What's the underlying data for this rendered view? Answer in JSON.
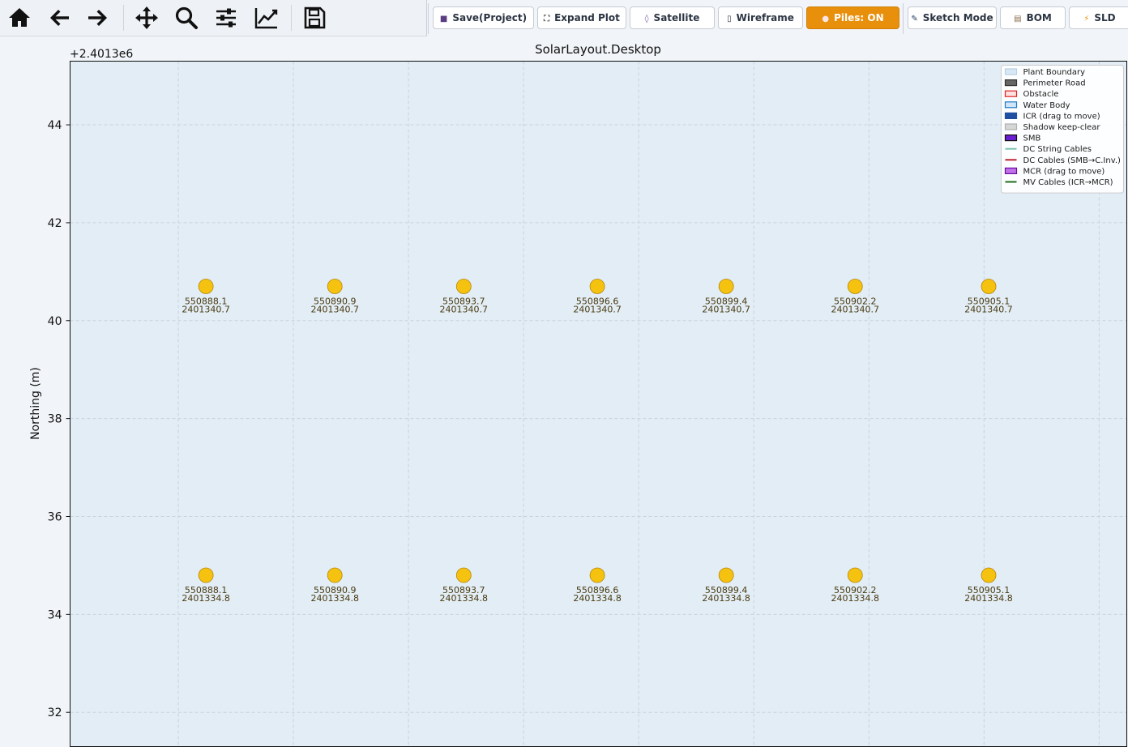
{
  "toolbar": {
    "nav_tools": [
      {
        "name": "home-icon"
      },
      {
        "name": "back-arrow-icon"
      },
      {
        "name": "forward-arrow-icon"
      },
      {
        "name": "pan-icon"
      },
      {
        "name": "zoom-icon"
      },
      {
        "name": "configure-subplots-icon"
      },
      {
        "name": "edit-axis-icon"
      },
      {
        "name": "save-figure-icon"
      }
    ],
    "buttons": [
      {
        "name": "save-project-button",
        "icon": "save-icon",
        "label": "Save(Project)",
        "active": false
      },
      {
        "name": "expand-plot-button",
        "icon": "expand-icon",
        "label": "Expand Plot",
        "active": false
      },
      {
        "name": "satellite-button",
        "icon": "satellite-icon",
        "label": "Satellite",
        "active": false
      },
      {
        "name": "wireframe-button",
        "icon": "wireframe-icon",
        "label": "Wireframe",
        "active": false
      },
      {
        "name": "piles-toggle-button",
        "icon": "pin-icon",
        "label": "Piles: ON",
        "active": true
      },
      {
        "name": "sketch-mode-button",
        "icon": "pencil-icon",
        "label": "Sketch Mode",
        "active": false
      },
      {
        "name": "bom-button",
        "icon": "document-icon",
        "label": "BOM",
        "active": false
      },
      {
        "name": "sld-button",
        "icon": "lightning-icon",
        "label": "SLD",
        "active": false
      }
    ]
  },
  "plot": {
    "title": "SolarLayout.Desktop",
    "offset_label": "+2.4013e6",
    "ylabel": "Northing (m)",
    "accent_color": "#e8900c",
    "pile_color": "#f5c20f",
    "background_color": "#e2edf5"
  },
  "chart_data": {
    "type": "scatter",
    "ylim": [
      31.3,
      45.3
    ],
    "xlim": [
      550885.15,
      550908.1
    ],
    "y_ticks": [
      "32",
      "34",
      "36",
      "38",
      "40",
      "42",
      "44"
    ],
    "x_ticks_visible": false,
    "grid": true,
    "legend_position": "top-right",
    "points": [
      {
        "x": 550888.1,
        "y": 40.7,
        "label_x": "550888.1",
        "label_y": "2401340.7"
      },
      {
        "x": 550890.9,
        "y": 40.7,
        "label_x": "550890.9",
        "label_y": "2401340.7"
      },
      {
        "x": 550893.7,
        "y": 40.7,
        "label_x": "550893.7",
        "label_y": "2401340.7"
      },
      {
        "x": 550896.6,
        "y": 40.7,
        "label_x": "550896.6",
        "label_y": "2401340.7"
      },
      {
        "x": 550899.4,
        "y": 40.7,
        "label_x": "550899.4",
        "label_y": "2401340.7"
      },
      {
        "x": 550902.2,
        "y": 40.7,
        "label_x": "550902.2",
        "label_y": "2401340.7"
      },
      {
        "x": 550905.1,
        "y": 40.7,
        "label_x": "550905.1",
        "label_y": "2401340.7"
      },
      {
        "x": 550888.1,
        "y": 34.8,
        "label_x": "550888.1",
        "label_y": "2401334.8"
      },
      {
        "x": 550890.9,
        "y": 34.8,
        "label_x": "550890.9",
        "label_y": "2401334.8"
      },
      {
        "x": 550893.7,
        "y": 34.8,
        "label_x": "550893.7",
        "label_y": "2401334.8"
      },
      {
        "x": 550896.6,
        "y": 34.8,
        "label_x": "550896.6",
        "label_y": "2401334.8"
      },
      {
        "x": 550899.4,
        "y": 34.8,
        "label_x": "550899.4",
        "label_y": "2401334.8"
      },
      {
        "x": 550902.2,
        "y": 34.8,
        "label_x": "550902.2",
        "label_y": "2401334.8"
      },
      {
        "x": 550905.1,
        "y": 34.8,
        "label_x": "550905.1",
        "label_y": "2401334.8"
      }
    ],
    "legend": [
      {
        "label": "Plant Boundary",
        "swatch": "patch",
        "fill": "#d8e8f6",
        "stroke": "#b8cfe4"
      },
      {
        "label": "Perimeter Road",
        "swatch": "patch",
        "fill": "#666666",
        "stroke": "#333333"
      },
      {
        "label": "Obstacle",
        "swatch": "patch",
        "fill": "#fde0e0",
        "stroke": "#e02020"
      },
      {
        "label": "Water Body",
        "swatch": "patch",
        "fill": "#cfe6f8",
        "stroke": "#1f78c8"
      },
      {
        "label": "ICR (drag to move)",
        "swatch": "patch",
        "fill": "#1f4fa0",
        "stroke": "#1f4fa0"
      },
      {
        "label": "Shadow keep-clear",
        "swatch": "patch",
        "fill": "#d6d6d6",
        "stroke": "#b0b0b0"
      },
      {
        "label": "SMB",
        "swatch": "patch",
        "fill": "#6a1fd0",
        "stroke": "#111111"
      },
      {
        "label": "DC String Cables",
        "swatch": "line",
        "fill": "#7ac4b0",
        "stroke": "#7ac4b0"
      },
      {
        "label": "DC Cables (SMB→C.Inv.)",
        "swatch": "line",
        "fill": "#c02030",
        "stroke": "#c02030"
      },
      {
        "label": "MCR (drag to move)",
        "swatch": "patch",
        "fill": "#c070e8",
        "stroke": "#6a0aa0"
      },
      {
        "label": "MV Cables (ICR→MCR)",
        "swatch": "line",
        "fill": "#1e6e1e",
        "stroke": "#1e6e1e"
      }
    ]
  }
}
